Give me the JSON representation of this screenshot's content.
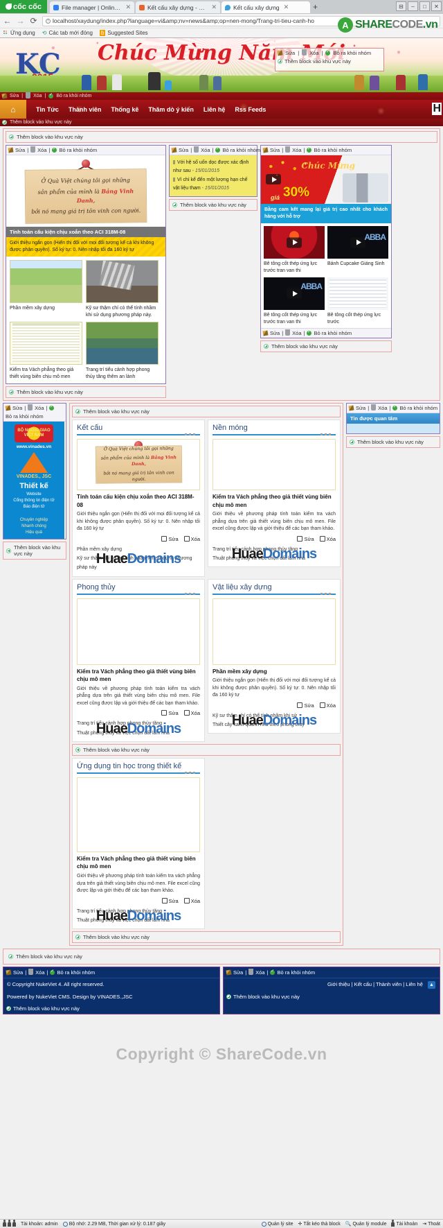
{
  "browser": {
    "brand": "cốc cốc",
    "tabs": [
      {
        "label": "File manager | Online file",
        "favicon": "#2d7ff9",
        "active": false
      },
      {
        "label": "Kết cấu xây dựng - Quản",
        "favicon": "#e8642c",
        "active": false
      },
      {
        "label": "Kết cấu xây dựng",
        "favicon": "#3aa0e0",
        "active": true
      }
    ],
    "new_tab": "+",
    "url": "localhost/xaydung/index.php?language=vi&amp;nv=news&amp;op=nen-mong/Trang-tri-tieu-canh-ho",
    "bookmarks": [
      "Ứng dụng",
      "Các tab mới đóng",
      "Suggested Sites"
    ],
    "window_buttons": [
      "☐",
      "–",
      "□",
      "✕"
    ],
    "watermark": {
      "brand": "SHARE",
      "brand2": "CODE",
      "tld": ".vn"
    }
  },
  "site": {
    "banner": {
      "greeting": "Chúc Mừng Năm Mới",
      "logo": "KC",
      "year": "2015",
      "overlay_toolbar": {
        "edit": "Sửa",
        "delete": "Xóa",
        "remove": "Bỏ ra khỏi nhóm"
      },
      "overlay_add": "Thêm block vào khu vực này"
    },
    "edit_strip": {
      "edit": "Sửa",
      "delete": "Xóa",
      "remove": "Bỏ ra khỏi nhóm"
    },
    "nav": {
      "home_icon": "home-icon",
      "items": [
        "Tin Tức",
        "Thành viên",
        "Thống kê",
        "Thăm dò ý kiến",
        "Liên hệ",
        "Rss Feeds"
      ],
      "right_badge": "H"
    },
    "add_block_label": "Thêm block vào khu vực này",
    "toolbar": {
      "edit": "Sửa",
      "delete": "Xóa",
      "remove": "Bỏ ra khỏi nhóm",
      "sep": "|"
    }
  },
  "featured": {
    "card": {
      "line1": "Ở Quà Việt chúng tôi gọi những",
      "line2_pre": "sản phẩm của mình là ",
      "line2_hl": "Bảng Vinh Danh,",
      "line3": "bởi nó mang giá trị tôn vinh con người."
    },
    "caption": "Tính toán cấu kiện chịu xoắn theo ACI 318M-08",
    "description": "Giới thiệu ngắn gọn (Hiển thị đối với mọi đối tượng kể cả khi không được phân quyền). Số ký tự: 0. Nên nhập tối đa 160 ký tự",
    "thumbs": [
      {
        "title": "Phần mềm xây dựng",
        "img": "house"
      },
      {
        "title": "Kỹ sư thậm chí có thể tính nhầm khi sử dụng phương pháp này.",
        "img": "quake"
      },
      {
        "title": "Kiểm tra Vách phẳng theo giả thiết vùng biên chịu mô men",
        "img": "sheet"
      },
      {
        "title": "Trang trí tiểu cảnh hợp phong thủy tăng thêm an lành",
        "img": "pond"
      }
    ]
  },
  "note_block": {
    "items": [
      {
        "text": "Với hệ số uốn dọc được xác định như sau",
        "date": "- 15/01/2015"
      },
      {
        "text": "Vì chỉ kể đến một lượng hạn chế vật liệu tham",
        "date": "- 15/01/2015"
      }
    ]
  },
  "video_block": {
    "hero": {
      "percent": "30%",
      "gia": "giá",
      "greeting": "Chúc Mừng"
    },
    "hero_caption": "Bằng cam kết mang lại giá trị cao nhất cho khách hàng với hỗ trợ",
    "videos": [
      {
        "title": "Bê tông cốt thép ứng lực trước tran van thi",
        "thumb": "vt1"
      },
      {
        "title": "Bánh Cupcake Giáng Sinh",
        "thumb": "vt2"
      },
      {
        "title": "Bê tông cốt thép ứng lực trước tran van thi",
        "thumb": "vt3"
      },
      {
        "title": "Bê tông cốt thép ứng lực trước",
        "thumb": "vt4"
      }
    ]
  },
  "vinades": {
    "seal": "BỘ NGOẠI GIAO VIỆT NAM",
    "url": "www.vinades.vn",
    "company": "VINADES., JSC",
    "headline": "Thiết kế",
    "sub1": "Website\nCổng thông tin điện tử\nBáo điện tử",
    "sub2": "Chuyên nghiệp\nNhanh chóng\nHiệu quả"
  },
  "quan_tam": {
    "header": "Tin được quan tâm"
  },
  "sections": [
    {
      "title": "Kết cấu",
      "img": "card",
      "headline": "Tính toán cấu kiện chịu xoắn theo ACI 318M-08",
      "body": "Giới thiệu ngắn gọn (Hiển thị đối với mọi đối tượng kể cả khi không được phân quyền). Số ký tự: 0. Nên nhập tối đa 160 ký tự",
      "actions": {
        "edit": "Sửa",
        "delete": "Xóa"
      },
      "list": [
        "Phần mềm xây dựng",
        "Kỹ sư thậm chí có thể tính nhầm khi sử dụng phương pháp này"
      ],
      "watermark_a": "Huae",
      "watermark_b": "Domains"
    },
    {
      "title": "Nền móng",
      "img": "sheet",
      "headline": "Kiểm tra Vách phẳng theo giả thiết vùng biên chịu mô men",
      "body": "Giới thiệu về phương pháp tính toán kiểm tra vách phẳng dựa trên giả thiết vùng biên chịu mô men. File excel cũng được lập và giới thiệu để các bạn tham khảo.",
      "actions": {
        "edit": "Sửa",
        "delete": "Xóa"
      },
      "list": [
        "Trang trí tiểu cảnh hợp phong thủy tăng",
        "Thuật phong thủy và việc chọn đất làm nhà"
      ],
      "watermark_a": "Huae",
      "watermark_b": "Domains"
    },
    {
      "title": "Phong thủy",
      "img": "sheet",
      "headline": "Kiểm tra Vách phẳng theo giả thiết vùng biên chịu mô men",
      "body": "Giới thiệu về phương pháp tính toán kiểm tra vách phẳng dựa trên giả thiết vùng biên chịu mô men. File excel cũng được lập và giới thiệu để các bạn tham khảo.",
      "actions": {
        "edit": "Sửa",
        "delete": "Xóa"
      },
      "list": [
        "Trang trí tiểu cảnh hợp phong thủy tăng",
        "Thuật phong thủy và việc chọn đất làm nhà"
      ],
      "watermark_a": "Huae",
      "watermark_b": "Domains"
    },
    {
      "title": "Vật liệu xây dựng",
      "img": "garden2",
      "headline": "Phần mềm xây dựng",
      "body": "Giới thiệu ngắn gọn (Hiển thị đối với mọi đối tượng kể cả khi không được phân quyền). Số ký tự: 0. Nên nhập tối đa 160 ký tự",
      "actions": {
        "edit": "Sửa",
        "delete": "Xóa"
      },
      "list": [
        "Kỹ sư thậm chí có thể tính nhầm khi sử",
        "Thiết cây xanh quanh nhà theo phong thủy"
      ],
      "watermark_a": "Huae",
      "watermark_b": "Domains"
    },
    {
      "title": "Ứng dụng tin học trong thiết kế",
      "img": "sheet",
      "headline": "Kiểm tra Vách phẳng theo giả thiết vùng biên chịu mô men",
      "body": "Giới thiệu về phương pháp tính toán kiểm tra vách phẳng dựa trên giả thiết vùng biên chịu mô men. File excel cũng được lập và giới thiệu để các bạn tham khảo.",
      "actions": {
        "edit": "Sửa",
        "delete": "Xóa"
      },
      "list": [
        "Trang trí tiểu cảnh hợp phong thủy tăng",
        "Thuật phong thủy và việc chọn đất làm nhà"
      ],
      "watermark_a": "Huae",
      "watermark_b": "Domains"
    }
  ],
  "page_watermark": "Copyright © ShareCode.vn",
  "footer": {
    "left": {
      "line1": "© Copyright NukeViet 4. All right reserved.",
      "line2": "Powered by NukeViet CMS. Design by VINADES.,JSC"
    },
    "right_links": [
      "Giới thiệu",
      "Kết cấu",
      "Thành viên",
      "Liên hệ"
    ],
    "up_button": "▲"
  },
  "adminbar": {
    "account": "Tài khoản: admin",
    "memory": "Bộ nhớ: 2.29 MB, Thời gian xử lý: 0.187 giây",
    "right": [
      {
        "label": "Quản lý site",
        "icon": "gear-icon"
      },
      {
        "label": "Tắt kéo thả block",
        "icon": "move-icon"
      },
      {
        "label": "Quản lý module",
        "icon": "search-icon"
      },
      {
        "label": "Tài khoản",
        "icon": "user-icon"
      },
      {
        "label": "Thoát",
        "icon": "exit-icon"
      }
    ]
  }
}
